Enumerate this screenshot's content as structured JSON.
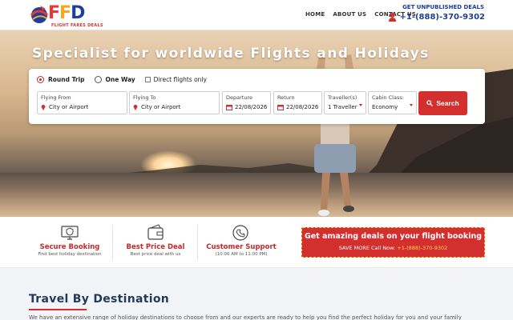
{
  "header": {
    "logo_text": "FFD",
    "logo_tagline": "FLIGHT FARES DEALS",
    "nav": [
      {
        "label": "HOME"
      },
      {
        "label": "ABOUT US"
      },
      {
        "label": "CONTACT US"
      }
    ],
    "unpublished_label": "GET UNPUBLISHED DEALS",
    "phone": "+1-(888)-370-9302"
  },
  "hero": {
    "title": "Specialist for worldwide Flights and Holidays"
  },
  "search": {
    "trip_options": [
      {
        "label": "Round Trip",
        "selected": true
      },
      {
        "label": "One Way",
        "selected": false
      }
    ],
    "direct_label": "Direct flights only",
    "from": {
      "label": "Flying From",
      "value": "City or Airport"
    },
    "to": {
      "label": "Flying To",
      "value": "City or Airport"
    },
    "departure": {
      "label": "Departure",
      "value": "22/08/2026"
    },
    "return": {
      "label": "Return",
      "value": "22/08/2026"
    },
    "travellers": {
      "label": "Traveller(s)",
      "value": "1 Traveller"
    },
    "cabin": {
      "label": "Cabin Class:",
      "value": "Economy"
    },
    "button_label": "Search"
  },
  "features": [
    {
      "title": "Secure Booking",
      "subtitle": "Find best holiday destination",
      "icon": "shield-monitor-icon"
    },
    {
      "title": "Best Price Deal",
      "subtitle": "Best price deal with us",
      "icon": "wallet-icon"
    },
    {
      "title": "Customer Support",
      "subtitle": "(10:00 AM to 11:00 PM)",
      "icon": "support-icon"
    }
  ],
  "deal_banner": {
    "title": "Get amazing deals on your flight booking",
    "prefix": "SAVE MORE Call Now: ",
    "phone": "+1-(888)-370-9302"
  },
  "destinations": {
    "title": "Travel By Destination",
    "intro": "We have an extensive range of holiday destinations to choose from and our experts are ready to help you find the perfect holiday for you and your family"
  },
  "colors": {
    "brand_blue": "#1d3e9a",
    "accent_red": "#d32f2f",
    "deal_border": "#f9d24a"
  }
}
